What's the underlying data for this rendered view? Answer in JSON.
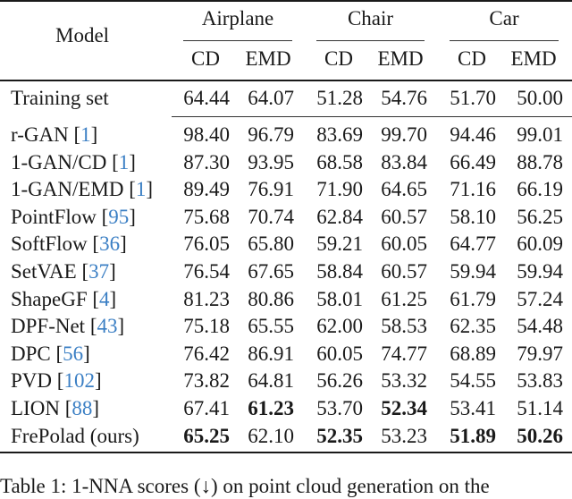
{
  "table": {
    "model_header": "Model",
    "groups": [
      "Airplane",
      "Chair",
      "Car"
    ],
    "metrics": [
      "CD",
      "EMD",
      "CD",
      "EMD",
      "CD",
      "EMD"
    ],
    "training_row": {
      "label": "Training set",
      "values": [
        "64.44",
        "64.07",
        "51.28",
        "54.76",
        "51.70",
        "50.00"
      ],
      "bold": [
        false,
        false,
        false,
        false,
        false,
        false
      ]
    },
    "rows": [
      {
        "name": "r-GAN",
        "cite": "1",
        "values": [
          "98.40",
          "96.79",
          "83.69",
          "99.70",
          "94.46",
          "99.01"
        ],
        "bold": [
          false,
          false,
          false,
          false,
          false,
          false
        ]
      },
      {
        "name": "1-GAN/CD",
        "cite": "1",
        "values": [
          "87.30",
          "93.95",
          "68.58",
          "83.84",
          "66.49",
          "88.78"
        ],
        "bold": [
          false,
          false,
          false,
          false,
          false,
          false
        ]
      },
      {
        "name": "1-GAN/EMD",
        "cite": "1",
        "values": [
          "89.49",
          "76.91",
          "71.90",
          "64.65",
          "71.16",
          "66.19"
        ],
        "bold": [
          false,
          false,
          false,
          false,
          false,
          false
        ]
      },
      {
        "name": "PointFlow",
        "cite": "95",
        "values": [
          "75.68",
          "70.74",
          "62.84",
          "60.57",
          "58.10",
          "56.25"
        ],
        "bold": [
          false,
          false,
          false,
          false,
          false,
          false
        ]
      },
      {
        "name": "SoftFlow",
        "cite": "36",
        "values": [
          "76.05",
          "65.80",
          "59.21",
          "60.05",
          "64.77",
          "60.09"
        ],
        "bold": [
          false,
          false,
          false,
          false,
          false,
          false
        ]
      },
      {
        "name": "SetVAE",
        "cite": "37",
        "values": [
          "76.54",
          "67.65",
          "58.84",
          "60.57",
          "59.94",
          "59.94"
        ],
        "bold": [
          false,
          false,
          false,
          false,
          false,
          false
        ]
      },
      {
        "name": "ShapeGF",
        "cite": "4",
        "values": [
          "81.23",
          "80.86",
          "58.01",
          "61.25",
          "61.79",
          "57.24"
        ],
        "bold": [
          false,
          false,
          false,
          false,
          false,
          false
        ]
      },
      {
        "name": "DPF-Net",
        "cite": "43",
        "values": [
          "75.18",
          "65.55",
          "62.00",
          "58.53",
          "62.35",
          "54.48"
        ],
        "bold": [
          false,
          false,
          false,
          false,
          false,
          false
        ]
      },
      {
        "name": "DPC",
        "cite": "56",
        "values": [
          "76.42",
          "86.91",
          "60.05",
          "74.77",
          "68.89",
          "79.97"
        ],
        "bold": [
          false,
          false,
          false,
          false,
          false,
          false
        ]
      },
      {
        "name": "PVD",
        "cite": "102",
        "values": [
          "73.82",
          "64.81",
          "56.26",
          "53.32",
          "54.55",
          "53.83"
        ],
        "bold": [
          false,
          false,
          false,
          false,
          false,
          false
        ]
      },
      {
        "name": "LION",
        "cite": "88",
        "values": [
          "67.41",
          "61.23",
          "53.70",
          "52.34",
          "53.41",
          "51.14"
        ],
        "bold": [
          false,
          true,
          false,
          true,
          false,
          false
        ]
      },
      {
        "name": "FrePolad (ours)",
        "cite": null,
        "values": [
          "65.25",
          "62.10",
          "52.35",
          "53.23",
          "51.89",
          "50.26"
        ],
        "bold": [
          true,
          false,
          true,
          false,
          true,
          true
        ]
      }
    ]
  },
  "caption": "Table 1: 1-NNA scores (↓) on point cloud generation on the",
  "colors": {
    "citation": "#3b7fc4",
    "text": "#1a1a1a"
  }
}
